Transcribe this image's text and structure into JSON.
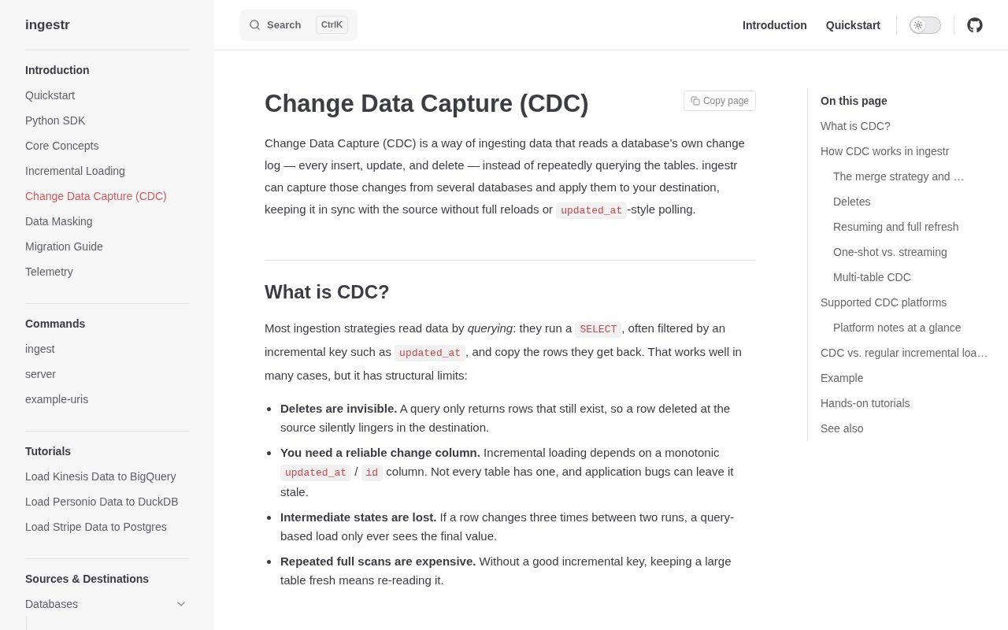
{
  "sidebar": {
    "title": "ingestr",
    "sections": [
      {
        "heading": "Introduction",
        "items": [
          {
            "kind": "link",
            "label": "Quickstart",
            "selected": false
          },
          {
            "kind": "link",
            "label": "Python SDK",
            "selected": false
          },
          {
            "kind": "link",
            "label": "Core Concepts",
            "selected": false
          },
          {
            "kind": "link",
            "label": "Incremental Loading",
            "selected": false
          },
          {
            "kind": "link",
            "label": "Change Data Capture (CDC)",
            "selected": true
          },
          {
            "kind": "link",
            "label": "Data Masking",
            "selected": false
          },
          {
            "kind": "link",
            "label": "Migration Guide",
            "selected": false
          },
          {
            "kind": "link",
            "label": "Telemetry",
            "selected": false
          }
        ]
      },
      {
        "heading": "Commands",
        "items": [
          {
            "kind": "link",
            "label": "ingest",
            "selected": false
          },
          {
            "kind": "link",
            "label": "server",
            "selected": false
          },
          {
            "kind": "link",
            "label": "example-uris",
            "selected": false
          }
        ]
      },
      {
        "heading": "Tutorials",
        "items": [
          {
            "kind": "link",
            "label": "Load Kinesis Data to BigQuery",
            "selected": false
          },
          {
            "kind": "link",
            "label": "Load Personio Data to DuckDB",
            "selected": false
          },
          {
            "kind": "link",
            "label": "Load Stripe Data to Postgres",
            "selected": false
          }
        ]
      },
      {
        "heading": "Sources & Destinations",
        "items": [
          {
            "kind": "group",
            "label": "Databases",
            "selected": false,
            "expanded": true
          }
        ]
      }
    ]
  },
  "header": {
    "search": {
      "label": "Search",
      "shortcut": "CtrlK"
    },
    "nav": [
      {
        "label": "Introduction"
      },
      {
        "label": "Quickstart"
      }
    ],
    "theme_toggle": {
      "on": false
    }
  },
  "article": {
    "title": "Change Data Capture (CDC)",
    "copy_button": "Copy page",
    "intro": [
      {
        "kind": "text",
        "text": "Change Data Capture (CDC) is a way of ingesting data that reads a database's own change log — every insert, update, and delete — instead of repeatedly querying the tables. ingestr can capture those changes from several databases and apply them to your destination, keeping it in sync with the source without full reloads or "
      },
      {
        "kind": "code",
        "text": "updated_at"
      },
      {
        "kind": "text",
        "text": "-style polling."
      }
    ],
    "sections": [
      {
        "heading": "What is CDC?",
        "paragraph": [
          {
            "kind": "text",
            "text": "Most ingestion strategies read data by *querying*: they run a "
          },
          {
            "kind": "code",
            "text": "SELECT"
          },
          {
            "kind": "text",
            "text": ", often filtered by an incremental key such as "
          },
          {
            "kind": "code",
            "text": "updated_at"
          },
          {
            "kind": "text",
            "text": ", and copy the rows they get back. That works well in many cases, but it has structural limits:"
          }
        ],
        "bullets": [
          [
            {
              "kind": "text",
              "text": "**Deletes are invisible.** A query only returns rows that still exist, so a row deleted at the source silently lingers in the destination."
            }
          ],
          [
            {
              "kind": "text",
              "text": "**You need a reliable change column.** Incremental loading depends on a monotonic "
            },
            {
              "kind": "code",
              "text": "updated_at"
            },
            {
              "kind": "text",
              "text": " / "
            },
            {
              "kind": "code",
              "text": "id"
            },
            {
              "kind": "text",
              "text": " column. Not every table has one, and application bugs can leave it stale."
            }
          ],
          [
            {
              "kind": "text",
              "text": "**Intermediate states are lost.** If a row changes three times between two runs, a query-based load only ever sees the final value."
            }
          ],
          [
            {
              "kind": "text",
              "text": "**Repeated full scans are expensive.** Without a good incremental key, keeping a large table fresh means re-reading it."
            }
          ]
        ]
      }
    ]
  },
  "toc": {
    "heading": "On this page",
    "items": [
      {
        "label": "What is CDC?"
      },
      {
        "label": "How CDC works in ingestr",
        "children": [
          {
            "label": "The merge strategy and …"
          },
          {
            "label": "Deletes"
          },
          {
            "label": "Resuming and full refresh"
          },
          {
            "label": "One-shot vs. streaming"
          },
          {
            "label": "Multi-table CDC"
          }
        ]
      },
      {
        "label": "Supported CDC platforms",
        "children": [
          {
            "label": "Platform notes at a glance"
          }
        ]
      },
      {
        "label": "CDC vs. regular incremental loa…"
      },
      {
        "label": "Example"
      },
      {
        "label": "Hands-on tutorials"
      },
      {
        "label": "See also"
      }
    ]
  }
}
